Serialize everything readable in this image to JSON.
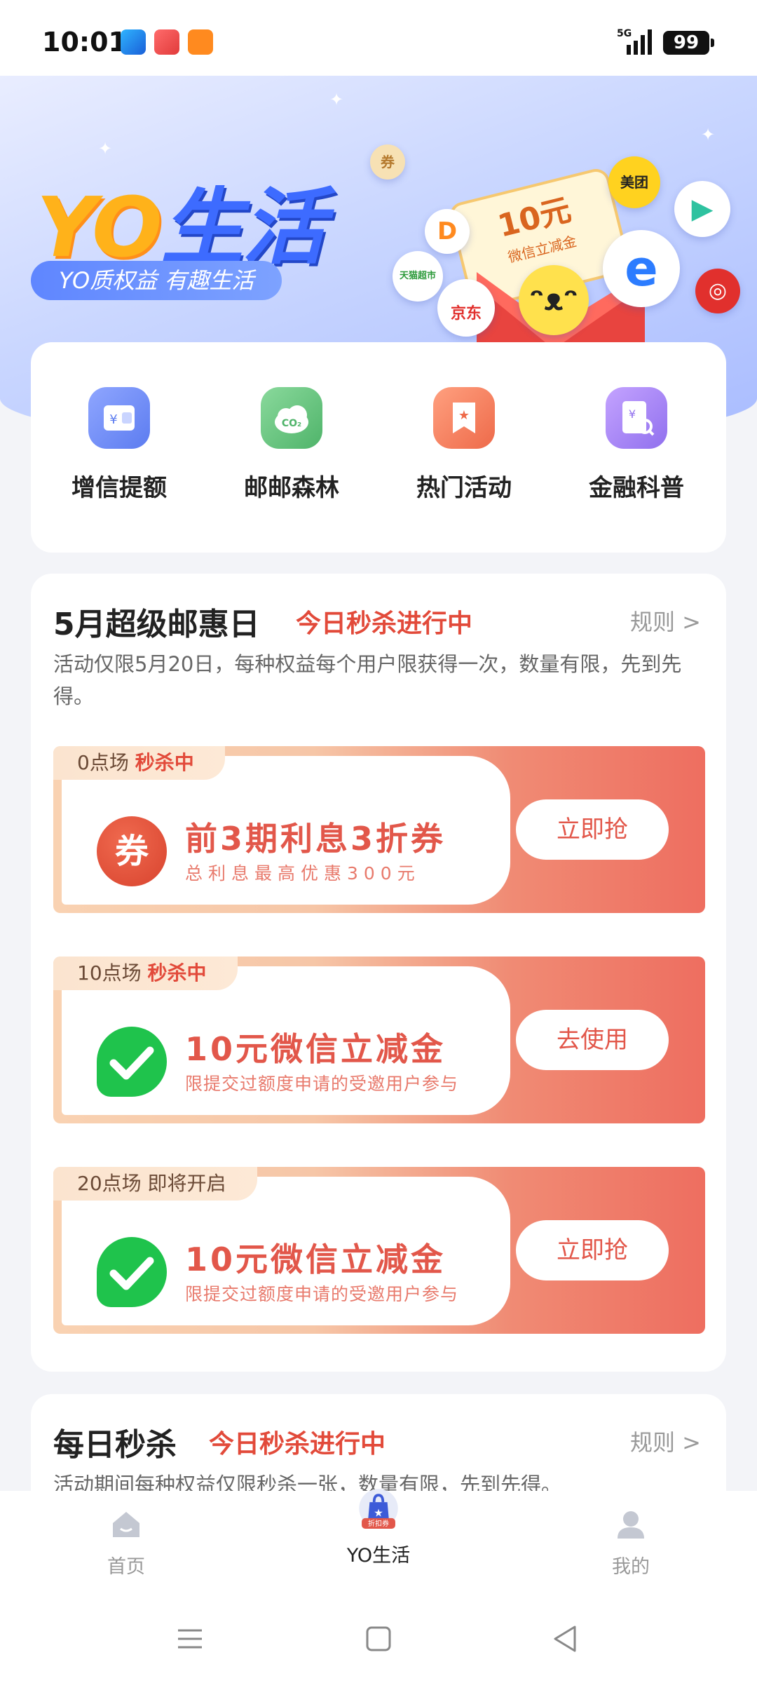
{
  "status_bar": {
    "time": "10:01",
    "network": "5G",
    "battery": "99"
  },
  "banner": {
    "brand_yo": "YO",
    "brand_life": "生活",
    "slogan": "YO质权益 有趣生活",
    "coupon_amount": "10元",
    "coupon_caption": "微信立减金",
    "partner_meituan": "美团",
    "partner_jd": "京东",
    "partner_tmall": "天猫超市"
  },
  "quick_menu": [
    {
      "label": "增信提额",
      "icon": "wallet-icon",
      "color": "#6f8cf6"
    },
    {
      "label": "邮邮森林",
      "icon": "co2-cloud-icon",
      "color": "#5fc27a"
    },
    {
      "label": "热门活动",
      "icon": "star-bookmark-icon",
      "color": "#f07a55"
    },
    {
      "label": "金融科普",
      "icon": "finance-search-icon",
      "color": "#a07af0"
    }
  ],
  "promo": {
    "title": "5月超级邮惠日",
    "tag": "今日秒杀进行中",
    "rules": "规则 >",
    "description": "活动仅限5月20日，每种权益每个用户限获得一次，数量有限，先到先得。",
    "deals": [
      {
        "session": "0点场",
        "status": "秒杀中",
        "title": "前3期利息3折券",
        "subtitle": "总利息最高优惠300元",
        "button": "立即抢",
        "icon": "coupon-icon"
      },
      {
        "session": "10点场",
        "status": "秒杀中",
        "title": "10元微信立减金",
        "subtitle": "限提交过额度申请的受邀用户参与",
        "button": "去使用",
        "icon": "wechat-icon"
      },
      {
        "session": "20点场",
        "status": "即将开启",
        "title": "10元微信立减金",
        "subtitle": "限提交过额度申请的受邀用户参与",
        "button": "立即抢",
        "icon": "wechat-icon"
      }
    ]
  },
  "daily": {
    "title": "每日秒杀",
    "tag": "今日秒杀进行中",
    "rules": "规则 >",
    "description": "活动期间每种权益仅限秒杀一张，数量有限，先到先得。"
  },
  "tab_bar": {
    "home": "首页",
    "center_badge": "折扣券",
    "life": "YO生活",
    "mine": "我的"
  },
  "colors": {
    "accent_red": "#e2574a",
    "brand_blue": "#3d6bff",
    "brand_orange": "#ffb21a"
  }
}
